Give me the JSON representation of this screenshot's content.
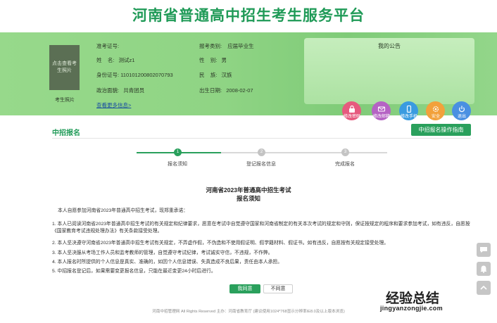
{
  "site_title": "河南省普通高中招生考生服务平台",
  "profile": {
    "photo_text_line1": "点击查看考",
    "photo_text_line2": "生照片",
    "photo_caption": "考生照片",
    "ticket_label": "准考证号:",
    "ticket_value": "",
    "category_label": "报考类别:",
    "category_value": "应届毕业生",
    "name_label": "姓    名:",
    "name_value": "测试z1",
    "gender_label": "性    别:",
    "gender_value": "男",
    "id_label": "身份证号:",
    "id_value": "110101200802070793",
    "ethnicity_label": "民    族:",
    "ethnicity_value": "汉族",
    "politics_label": "政治面貌:",
    "politics_value": "共青团员",
    "birth_label": "出生日期:",
    "birth_value": "2008-02-07",
    "more_link": "查看更多信息>"
  },
  "notice": {
    "title": "我的公告"
  },
  "quick_actions": [
    {
      "label": "修改密码",
      "icon": "lock-icon",
      "color": "#e65a7e"
    },
    {
      "label": "修改邮箱",
      "icon": "mail-icon",
      "color": "#b563c4"
    },
    {
      "label": "修改手机",
      "icon": "phone-icon",
      "color": "#3a9be0"
    },
    {
      "label": "安全",
      "icon": "settings-icon",
      "color": "#f2a13b"
    },
    {
      "label": "退出",
      "icon": "power-icon",
      "color": "#4a90e2"
    }
  ],
  "section_title": "中招报名",
  "guide_button": "中招报名操作指南",
  "steps": [
    {
      "num": "1",
      "label": "报名须知",
      "active": true
    },
    {
      "num": "2",
      "label": "登记报名信息",
      "active": false
    },
    {
      "num": "3",
      "label": "完成报名",
      "active": false
    }
  ],
  "document": {
    "title": "河南省2023年普通高中招生考试",
    "subtitle": "报名须知",
    "intro": "本人自愿参加河南省2023年普通高中招生考试，现郑重承诺：",
    "items": [
      "1. 本人已阅读河南省2023年普通高中招生考试的有关规定和纪律要求，愿意在考试中自觉遵守国家和河南省制定的有关本次考试的规定和守则，保证按规定的程序和要求参加考试，如有违反，自愿按《国家教育考试违规处理办法》有关条款接受处理。",
      "2. 本人坚决遵守河南省2023年普通高中招生考试有关规定，不弄虚作假，不伪造和不使用假证明、假学籍材料、假证书。如有违反，自愿按有关规定接受处理。",
      "3. 本人坚决服从考场工作人员和监考教师的管理，自觉遵守考试纪律，考试诚实守信，不违规，不作弊。",
      "4. 本人报名时所提供的个人信息是真实、准确的，如因个人信息错误、失真造成不良后果，责任由本人承担。",
      "5. 中招报名登记后，如果需要变更报名信息，只能在最近变更24小时后进行。"
    ]
  },
  "agree_button": "我同意",
  "disagree_button": "不同意",
  "footer": "河南中招管理网 All Rights Reserved 主办：河南省教育厅   (建议使用1024*768显示分辨率IE8.0及以上版本浏览)",
  "watermark": {
    "main": "经验总结",
    "sub": "jingyanzongjie.com"
  },
  "side_tools": [
    "chat-icon",
    "bell-icon",
    "back-to-top-icon"
  ]
}
